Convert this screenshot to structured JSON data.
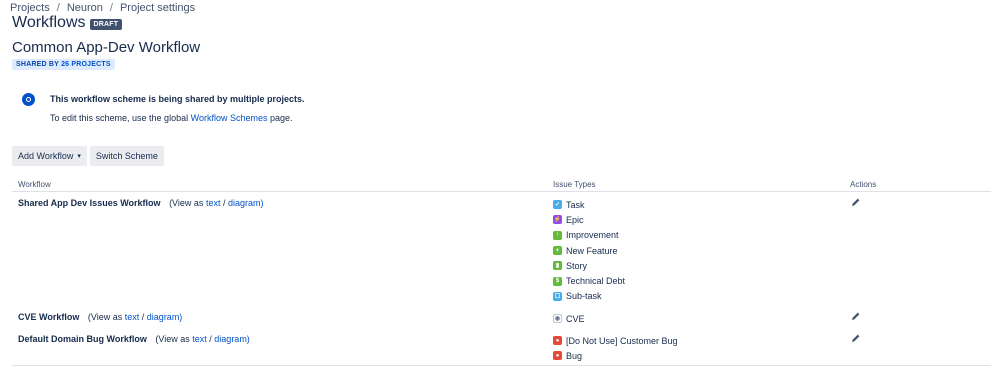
{
  "breadcrumb": [
    "Projects",
    "Neuron",
    "Project settings"
  ],
  "header": {
    "title": "Workflows",
    "status": "DRAFT"
  },
  "scheme": {
    "name": "Common App-Dev Workflow",
    "shared_prefix": "SHARED BY",
    "shared_link": "26 PROJECTS"
  },
  "info": {
    "heading": "This workflow scheme is being shared by multiple projects.",
    "text_before": "To edit this scheme, use the global",
    "link": "Workflow Schemes",
    "text_after": "page."
  },
  "toolbar": {
    "add_workflow": "Add Workflow",
    "switch_scheme": "Switch Scheme"
  },
  "table": {
    "headers": {
      "workflow": "Workflow",
      "issue_types": "Issue Types",
      "actions": "Actions"
    },
    "view_as": "(View as",
    "text_link": "text",
    "slash": "/",
    "diagram_link": "diagram)",
    "rows": [
      {
        "name": "Shared App Dev Issues Workflow",
        "issue_types": [
          {
            "label": "Task",
            "icon": "task-icon",
            "color": "#4bade8"
          },
          {
            "label": "Epic",
            "icon": "epic-icon",
            "color": "#904ee2"
          },
          {
            "label": "Improvement",
            "icon": "improvement-icon",
            "color": "#63ba3c"
          },
          {
            "label": "New Feature",
            "icon": "new-feature-icon",
            "color": "#63ba3c"
          },
          {
            "label": "Story",
            "icon": "story-icon",
            "color": "#63ba3c"
          },
          {
            "label": "Technical Debt",
            "icon": "technical-debt-icon",
            "color": "#63ba3c"
          },
          {
            "label": "Sub-task",
            "icon": "subtask-icon",
            "color": "#4bade8"
          }
        ]
      },
      {
        "name": "CVE Workflow",
        "issue_types": [
          {
            "label": "CVE",
            "icon": "cve-icon",
            "color": "#c1c7d0"
          }
        ]
      },
      {
        "name": "Default Domain Bug Workflow",
        "issue_types": [
          {
            "label": "[Do Not Use] Customer Bug",
            "icon": "bug-icon",
            "color": "#e5493a"
          },
          {
            "label": "Bug",
            "icon": "bug-icon",
            "color": "#e5493a"
          }
        ]
      }
    ]
  }
}
